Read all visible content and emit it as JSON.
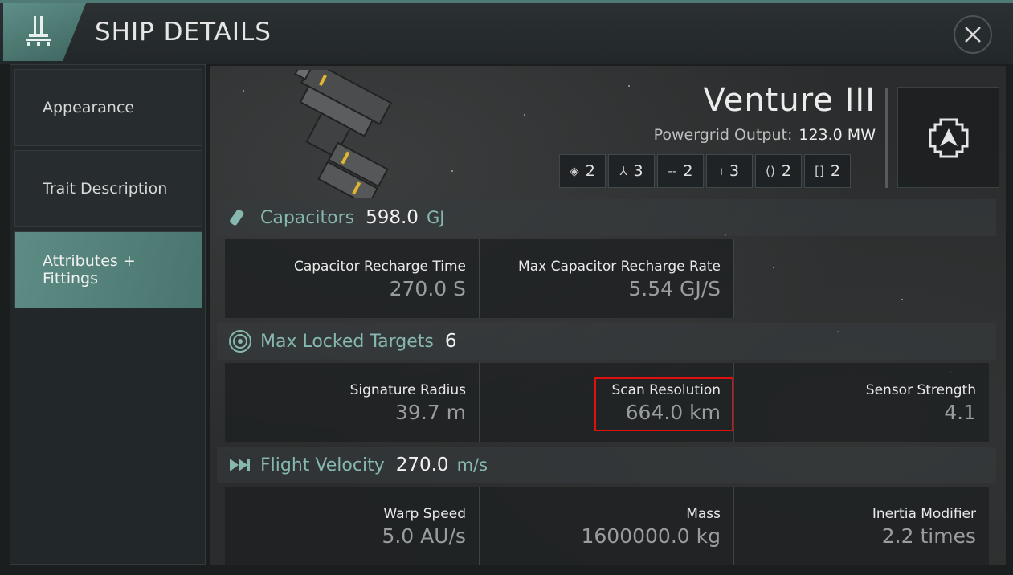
{
  "header": {
    "title": "SHIP DETAILS",
    "badge_icon": "ship-tower-icon",
    "close_icon": "close-icon"
  },
  "sidebar": {
    "items": [
      {
        "label": "Appearance",
        "active": false
      },
      {
        "label": "Trait Description",
        "active": false
      },
      {
        "label": "Attributes +\nFittings",
        "active": true
      }
    ]
  },
  "ship": {
    "name": "Venture III",
    "powergrid_label": "Powergrid Output:",
    "powergrid_value": "123.0 MW",
    "emblem_icon": "ship-class-emblem-icon"
  },
  "slots": [
    {
      "icon": "drone-slot-icon",
      "count": "2"
    },
    {
      "icon": "high-slot-icon",
      "count": "3"
    },
    {
      "icon": "mid-slot-icon",
      "count": "2"
    },
    {
      "icon": "low-slot-icon",
      "count": "3"
    },
    {
      "icon": "rig-slot-icon",
      "count": "2"
    },
    {
      "icon": "subsystem-slot-icon",
      "count": "2"
    }
  ],
  "sections": {
    "capacitors": {
      "name": "Capacitors",
      "value": "598.0",
      "unit": "GJ",
      "icon": "capacitor-icon",
      "stats": [
        {
          "label": "Capacitor Recharge Time",
          "value": "270.0 S"
        },
        {
          "label": "Max Capacitor Recharge Rate",
          "value": "5.54 GJ/S"
        }
      ]
    },
    "targeting": {
      "name": "Max Locked Targets",
      "value": "6",
      "unit": "",
      "icon": "target-lock-icon",
      "stats": [
        {
          "label": "Signature Radius",
          "value": "39.7 m"
        },
        {
          "label": "Scan Resolution",
          "value": "664.0 km"
        },
        {
          "label": "Sensor Strength",
          "value": "4.1"
        }
      ]
    },
    "velocity": {
      "name": "Flight Velocity",
      "value": "270.0",
      "unit": "m/s",
      "icon": "fast-forward-icon",
      "stats": [
        {
          "label": "Warp Speed",
          "value": "5.0 AU/s"
        },
        {
          "label": "Mass",
          "value": "1600000.0 kg"
        },
        {
          "label": "Inertia Modifier",
          "value": "2.2 times"
        }
      ]
    }
  },
  "colors": {
    "accent": "#86b8b0",
    "active_tab": "#5d8c85",
    "highlight": "#e01010"
  }
}
